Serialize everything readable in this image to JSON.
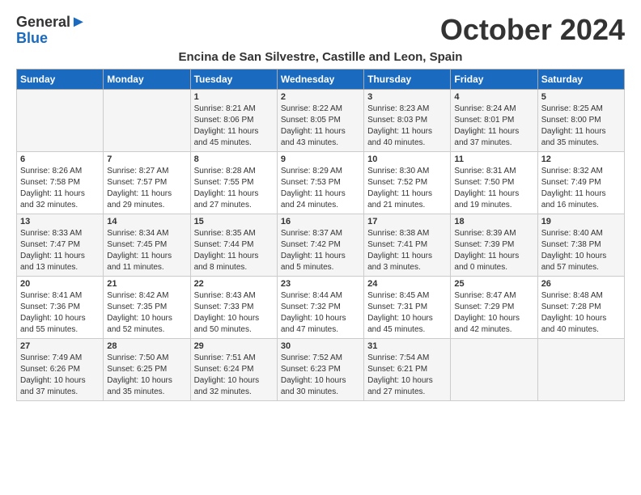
{
  "header": {
    "logo_line1": "General",
    "logo_line2": "Blue",
    "month_title": "October 2024",
    "subtitle": "Encina de San Silvestre, Castille and Leon, Spain"
  },
  "days_of_week": [
    "Sunday",
    "Monday",
    "Tuesday",
    "Wednesday",
    "Thursday",
    "Friday",
    "Saturday"
  ],
  "weeks": [
    [
      {
        "day": "",
        "info": ""
      },
      {
        "day": "",
        "info": ""
      },
      {
        "day": "1",
        "info": "Sunrise: 8:21 AM\nSunset: 8:06 PM\nDaylight: 11 hours and 45 minutes."
      },
      {
        "day": "2",
        "info": "Sunrise: 8:22 AM\nSunset: 8:05 PM\nDaylight: 11 hours and 43 minutes."
      },
      {
        "day": "3",
        "info": "Sunrise: 8:23 AM\nSunset: 8:03 PM\nDaylight: 11 hours and 40 minutes."
      },
      {
        "day": "4",
        "info": "Sunrise: 8:24 AM\nSunset: 8:01 PM\nDaylight: 11 hours and 37 minutes."
      },
      {
        "day": "5",
        "info": "Sunrise: 8:25 AM\nSunset: 8:00 PM\nDaylight: 11 hours and 35 minutes."
      }
    ],
    [
      {
        "day": "6",
        "info": "Sunrise: 8:26 AM\nSunset: 7:58 PM\nDaylight: 11 hours and 32 minutes."
      },
      {
        "day": "7",
        "info": "Sunrise: 8:27 AM\nSunset: 7:57 PM\nDaylight: 11 hours and 29 minutes."
      },
      {
        "day": "8",
        "info": "Sunrise: 8:28 AM\nSunset: 7:55 PM\nDaylight: 11 hours and 27 minutes."
      },
      {
        "day": "9",
        "info": "Sunrise: 8:29 AM\nSunset: 7:53 PM\nDaylight: 11 hours and 24 minutes."
      },
      {
        "day": "10",
        "info": "Sunrise: 8:30 AM\nSunset: 7:52 PM\nDaylight: 11 hours and 21 minutes."
      },
      {
        "day": "11",
        "info": "Sunrise: 8:31 AM\nSunset: 7:50 PM\nDaylight: 11 hours and 19 minutes."
      },
      {
        "day": "12",
        "info": "Sunrise: 8:32 AM\nSunset: 7:49 PM\nDaylight: 11 hours and 16 minutes."
      }
    ],
    [
      {
        "day": "13",
        "info": "Sunrise: 8:33 AM\nSunset: 7:47 PM\nDaylight: 11 hours and 13 minutes."
      },
      {
        "day": "14",
        "info": "Sunrise: 8:34 AM\nSunset: 7:45 PM\nDaylight: 11 hours and 11 minutes."
      },
      {
        "day": "15",
        "info": "Sunrise: 8:35 AM\nSunset: 7:44 PM\nDaylight: 11 hours and 8 minutes."
      },
      {
        "day": "16",
        "info": "Sunrise: 8:37 AM\nSunset: 7:42 PM\nDaylight: 11 hours and 5 minutes."
      },
      {
        "day": "17",
        "info": "Sunrise: 8:38 AM\nSunset: 7:41 PM\nDaylight: 11 hours and 3 minutes."
      },
      {
        "day": "18",
        "info": "Sunrise: 8:39 AM\nSunset: 7:39 PM\nDaylight: 11 hours and 0 minutes."
      },
      {
        "day": "19",
        "info": "Sunrise: 8:40 AM\nSunset: 7:38 PM\nDaylight: 10 hours and 57 minutes."
      }
    ],
    [
      {
        "day": "20",
        "info": "Sunrise: 8:41 AM\nSunset: 7:36 PM\nDaylight: 10 hours and 55 minutes."
      },
      {
        "day": "21",
        "info": "Sunrise: 8:42 AM\nSunset: 7:35 PM\nDaylight: 10 hours and 52 minutes."
      },
      {
        "day": "22",
        "info": "Sunrise: 8:43 AM\nSunset: 7:33 PM\nDaylight: 10 hours and 50 minutes."
      },
      {
        "day": "23",
        "info": "Sunrise: 8:44 AM\nSunset: 7:32 PM\nDaylight: 10 hours and 47 minutes."
      },
      {
        "day": "24",
        "info": "Sunrise: 8:45 AM\nSunset: 7:31 PM\nDaylight: 10 hours and 45 minutes."
      },
      {
        "day": "25",
        "info": "Sunrise: 8:47 AM\nSunset: 7:29 PM\nDaylight: 10 hours and 42 minutes."
      },
      {
        "day": "26",
        "info": "Sunrise: 8:48 AM\nSunset: 7:28 PM\nDaylight: 10 hours and 40 minutes."
      }
    ],
    [
      {
        "day": "27",
        "info": "Sunrise: 7:49 AM\nSunset: 6:26 PM\nDaylight: 10 hours and 37 minutes."
      },
      {
        "day": "28",
        "info": "Sunrise: 7:50 AM\nSunset: 6:25 PM\nDaylight: 10 hours and 35 minutes."
      },
      {
        "day": "29",
        "info": "Sunrise: 7:51 AM\nSunset: 6:24 PM\nDaylight: 10 hours and 32 minutes."
      },
      {
        "day": "30",
        "info": "Sunrise: 7:52 AM\nSunset: 6:23 PM\nDaylight: 10 hours and 30 minutes."
      },
      {
        "day": "31",
        "info": "Sunrise: 7:54 AM\nSunset: 6:21 PM\nDaylight: 10 hours and 27 minutes."
      },
      {
        "day": "",
        "info": ""
      },
      {
        "day": "",
        "info": ""
      }
    ]
  ]
}
